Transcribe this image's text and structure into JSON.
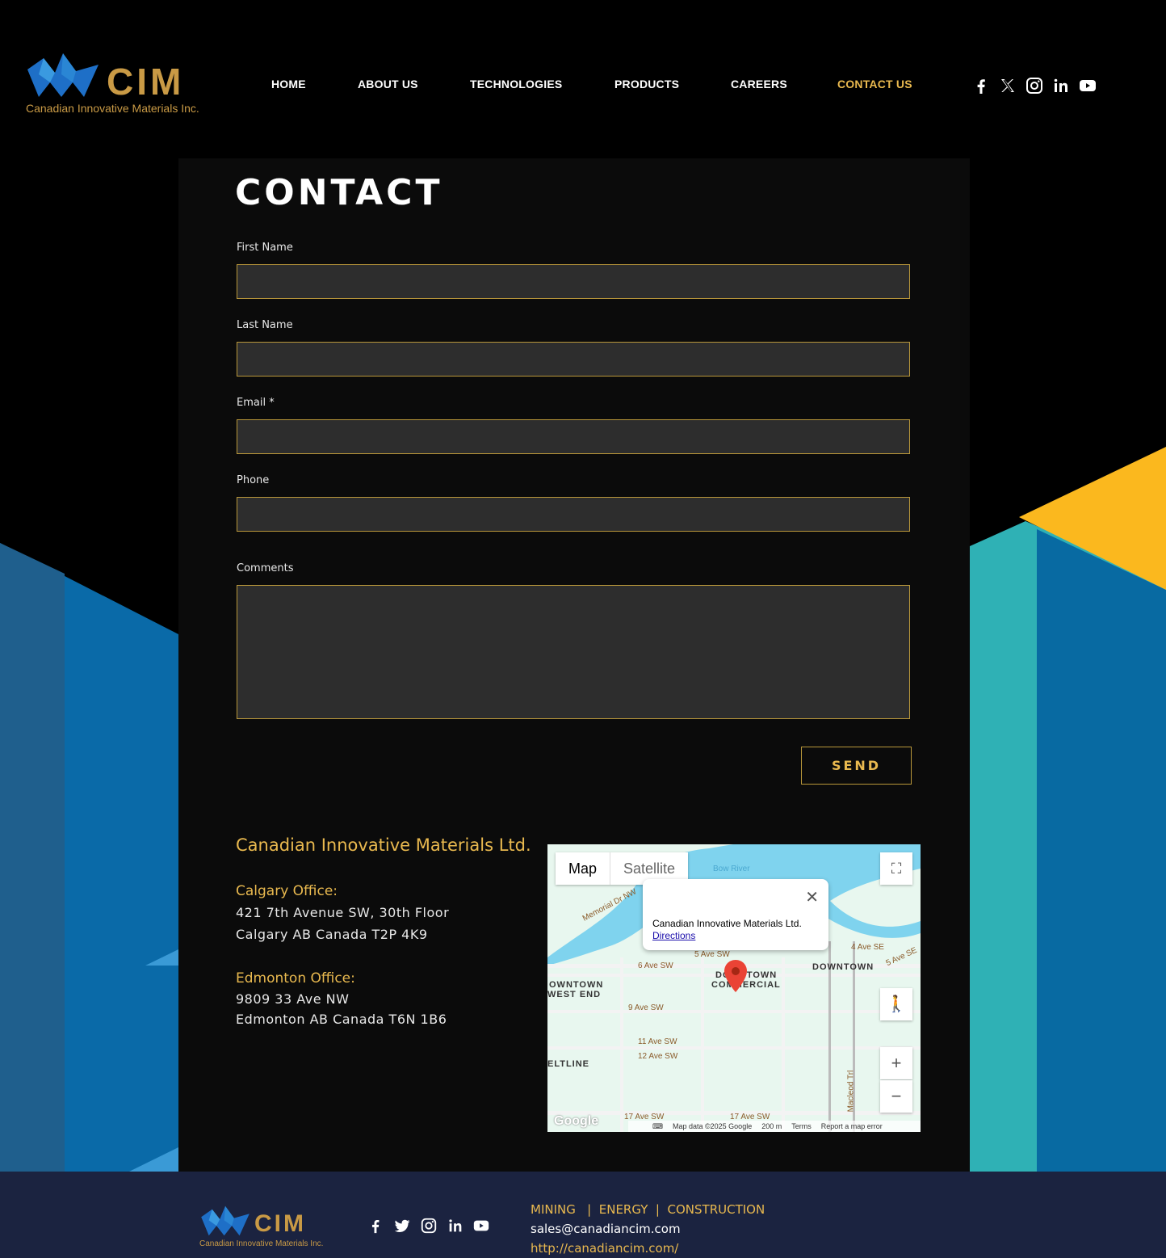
{
  "brand": {
    "wordmark": "CIM",
    "tagline": "Canadian Innovative Materials Inc."
  },
  "nav": {
    "items": [
      {
        "label": "HOME"
      },
      {
        "label": "ABOUT US"
      },
      {
        "label": "TECHNOLOGIES"
      },
      {
        "label": "PRODUCTS"
      },
      {
        "label": "CAREERS"
      },
      {
        "label": "CONTACT US",
        "active": true
      }
    ]
  },
  "social": [
    "facebook-icon",
    "x-icon",
    "instagram-icon",
    "linkedin-icon",
    "youtube-icon"
  ],
  "page": {
    "title": "CONTACT"
  },
  "form": {
    "first_name_label": "First Name",
    "last_name_label": "Last Name",
    "email_label": "Email *",
    "phone_label": "Phone",
    "comments_label": "Comments",
    "send_label": "SEND"
  },
  "company": {
    "name": "Canadian Innovative Materials Ltd.",
    "calgary_title": "Calgary Office:",
    "calgary_line1": "421 7th Avenue SW, 30th Floor",
    "calgary_line2": "Calgary AB Canada  T2P 4K9",
    "edmonton_title": "Edmonton Office:",
    "edmonton_line1": "9809 33 Ave NW",
    "edmonton_line2": "Edmonton AB Canada T6N 1B6"
  },
  "map": {
    "tab_map": "Map",
    "tab_satellite": "Satellite",
    "popup_title": "Canadian Innovative Materials Ltd.",
    "popup_link": "Directions",
    "labels": {
      "bow_river": "Bow River",
      "memorial": "Memorial Dr NW",
      "ave6": "6 Ave SW",
      "ave5": "5 Ave SW",
      "ave9": "9 Ave SW",
      "ave11": "11 Ave SW",
      "ave12": "12 Ave SW",
      "ave17a": "17 Ave SW",
      "ave17b": "17 Ave SW",
      "ave4se": "4 Ave SE",
      "ave5se": "5 Ave SE",
      "macleod": "Macleod Trl",
      "downtown": "DOWNTOWN",
      "dt_west1": "OWNTOWN",
      "dt_west2": "WEST END",
      "dt_comm1": "DOWNTOWN",
      "dt_comm2": "COMMERCIAL",
      "beltline": "ELTLINE"
    },
    "footer_data": "Map data ©2025 Google",
    "footer_scale": "200 m",
    "footer_terms": "Terms",
    "footer_report": "Report a map error",
    "google": "Google"
  },
  "footer": {
    "wordmark": "CIM",
    "tagline": "Canadian Innovative Materials Inc.",
    "tags": "MINING   |  ENERGY  |  CONSTRUCTION",
    "email": "sales@canadiancim.com",
    "url": "http://canadiancim.com/"
  },
  "colors": {
    "gold": "#e9b94f",
    "panel": "#0b0b0b",
    "field": "#2d2d2d",
    "footer": "#1b2340",
    "blue": "#0a6aa8",
    "teal": "#2fb1b5",
    "yellow": "#fbb81e"
  }
}
